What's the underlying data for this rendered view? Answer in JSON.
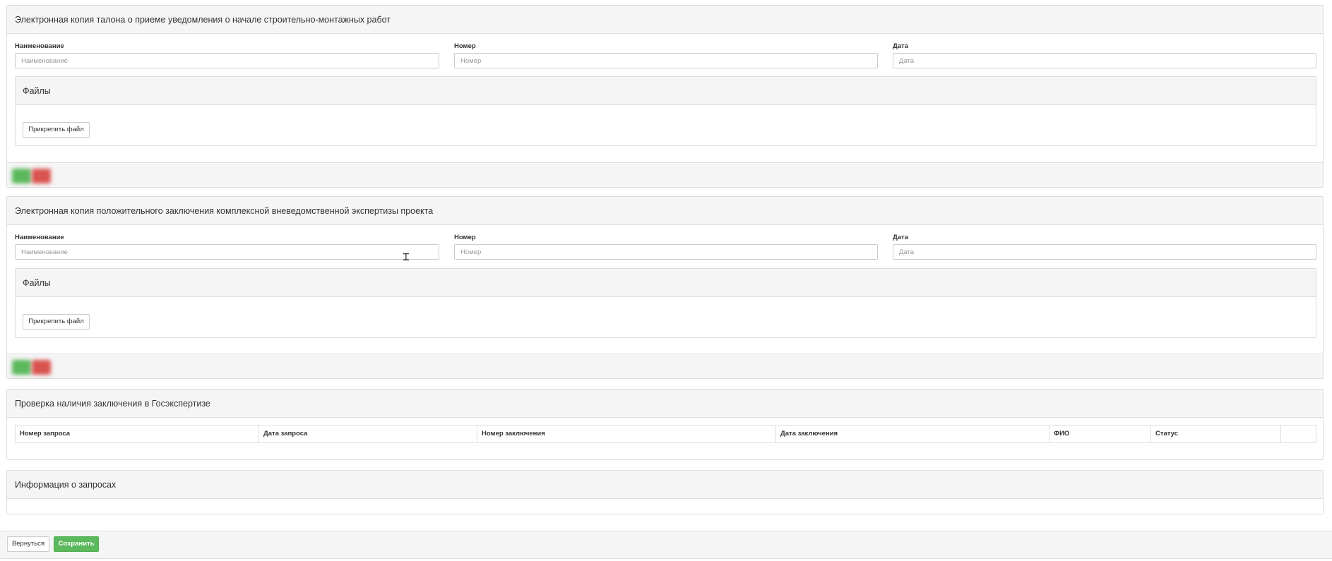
{
  "section1": {
    "title": "Электронная копия талона о приеме уведомления о начале строительно-монтажных работ",
    "fields": [
      {
        "label": "Наименование",
        "placeholder": "Наименование",
        "value": ""
      },
      {
        "label": "Номер",
        "placeholder": "Номер",
        "value": ""
      },
      {
        "label": "Дата",
        "placeholder": "Дата",
        "value": ""
      }
    ],
    "files_title": "Файлы",
    "attach_label": "Прикрепить файл"
  },
  "section2": {
    "title": "Электронная копия положительного заключения комплексной вневедомственной экспертизы проекта",
    "fields": [
      {
        "label": "Наименование",
        "placeholder": "Наименование",
        "value": ""
      },
      {
        "label": "Номер",
        "placeholder": "Номер",
        "value": ""
      },
      {
        "label": "Дата",
        "placeholder": "Дата",
        "value": ""
      }
    ],
    "files_title": "Файлы",
    "attach_label": "Прикрепить файл"
  },
  "section3": {
    "title": "Проверка наличия заключения в Госэкспертизе",
    "columns": [
      "Номер запроса",
      "Дата запроса",
      "Номер заключения",
      "Дата заключения",
      "ФИО",
      "Статус",
      ""
    ]
  },
  "section4": {
    "title": "Информация о запросах"
  },
  "footer": {
    "back_label": "Вернуться",
    "save_label": "Сохранить"
  },
  "colors": {
    "accept_green": "#5cb85c",
    "reject_red": "#d9534f",
    "panel_header_bg": "#f5f5f5",
    "border": "#dddddd"
  }
}
